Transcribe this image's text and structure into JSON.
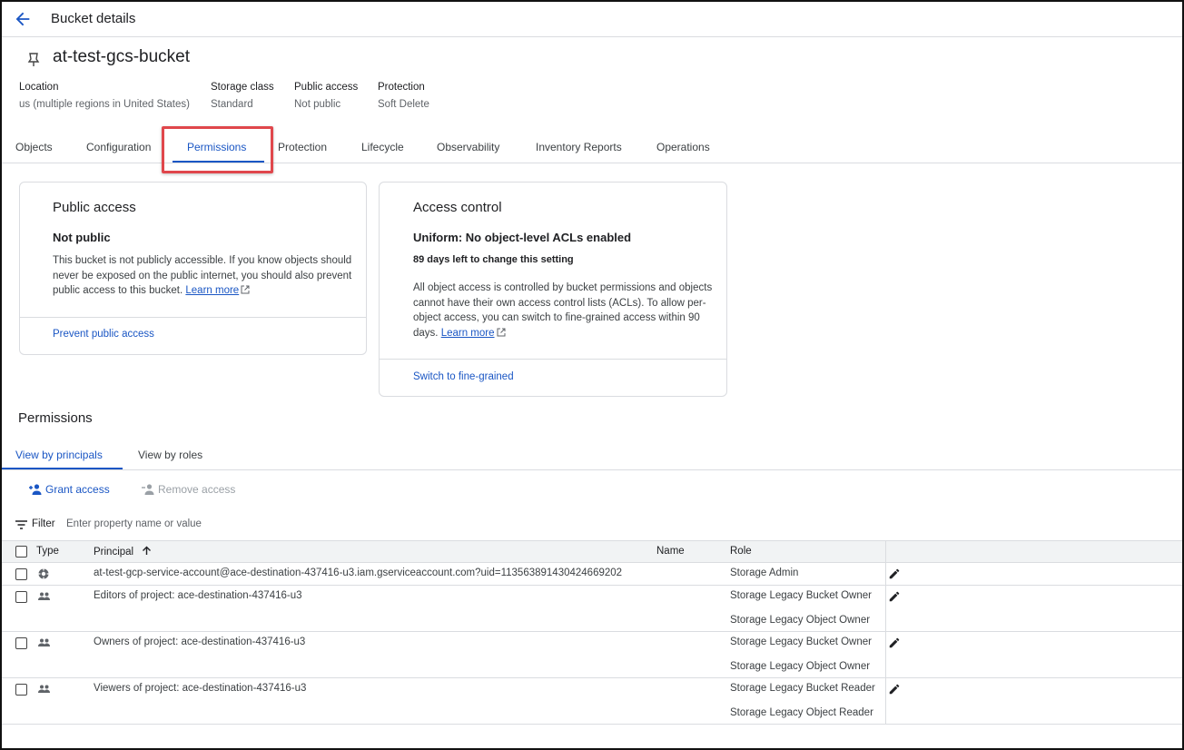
{
  "header": {
    "title": "Bucket details"
  },
  "bucket": {
    "name": "at-test-gcs-bucket"
  },
  "meta": [
    {
      "label": "Location",
      "value": "us (multiple regions in United States)"
    },
    {
      "label": "Storage class",
      "value": "Standard"
    },
    {
      "label": "Public access",
      "value": "Not public"
    },
    {
      "label": "Protection",
      "value": "Soft Delete"
    }
  ],
  "tabs": [
    "Objects",
    "Configuration",
    "Permissions",
    "Protection",
    "Lifecycle",
    "Observability",
    "Inventory Reports",
    "Operations"
  ],
  "active_tab": "Permissions",
  "public_access_card": {
    "title": "Public access",
    "status": "Not public",
    "description": "This bucket is not publicly accessible. If you know objects should never be exposed on the public internet, you should also prevent public access to this bucket.",
    "learn_more": "Learn more",
    "action": "Prevent public access"
  },
  "access_control_card": {
    "title": "Access control",
    "status": "Uniform: No object-level ACLs enabled",
    "days_left": "89 days left to change this setting",
    "description": "All object access is controlled by bucket permissions and objects cannot have their own access control lists (ACLs). To allow per-object access, you can switch to fine-grained access within 90 days.",
    "learn_more": "Learn more",
    "action": "Switch to fine-grained"
  },
  "permissions": {
    "title": "Permissions",
    "subtabs": [
      "View by principals",
      "View by roles"
    ],
    "grant_label": "Grant access",
    "remove_label": "Remove access",
    "filter_label": "Filter",
    "filter_placeholder": "Enter property name or value",
    "columns": {
      "type": "Type",
      "principal": "Principal",
      "name": "Name",
      "role": "Role"
    },
    "rows": [
      {
        "type_icon": "service-account-icon",
        "principal": "at-test-gcp-service-account@ace-destination-437416-u3.iam.gserviceaccount.com?uid=113563891430424669202",
        "name": "",
        "roles": [
          "Storage Admin"
        ]
      },
      {
        "type_icon": "group-icon",
        "principal": "Editors of project: ace-destination-437416-u3",
        "name": "",
        "roles": [
          "Storage Legacy Bucket Owner",
          "Storage Legacy Object Owner"
        ]
      },
      {
        "type_icon": "group-icon",
        "principal": "Owners of project: ace-destination-437416-u3",
        "name": "",
        "roles": [
          "Storage Legacy Bucket Owner",
          "Storage Legacy Object Owner"
        ]
      },
      {
        "type_icon": "group-icon",
        "principal": "Viewers of project: ace-destination-437416-u3",
        "name": "",
        "roles": [
          "Storage Legacy Bucket Reader",
          "Storage Legacy Object Reader"
        ]
      }
    ]
  },
  "colors": {
    "accent": "#1a56c4",
    "highlight": "#e0474c",
    "border": "#dadce0"
  }
}
